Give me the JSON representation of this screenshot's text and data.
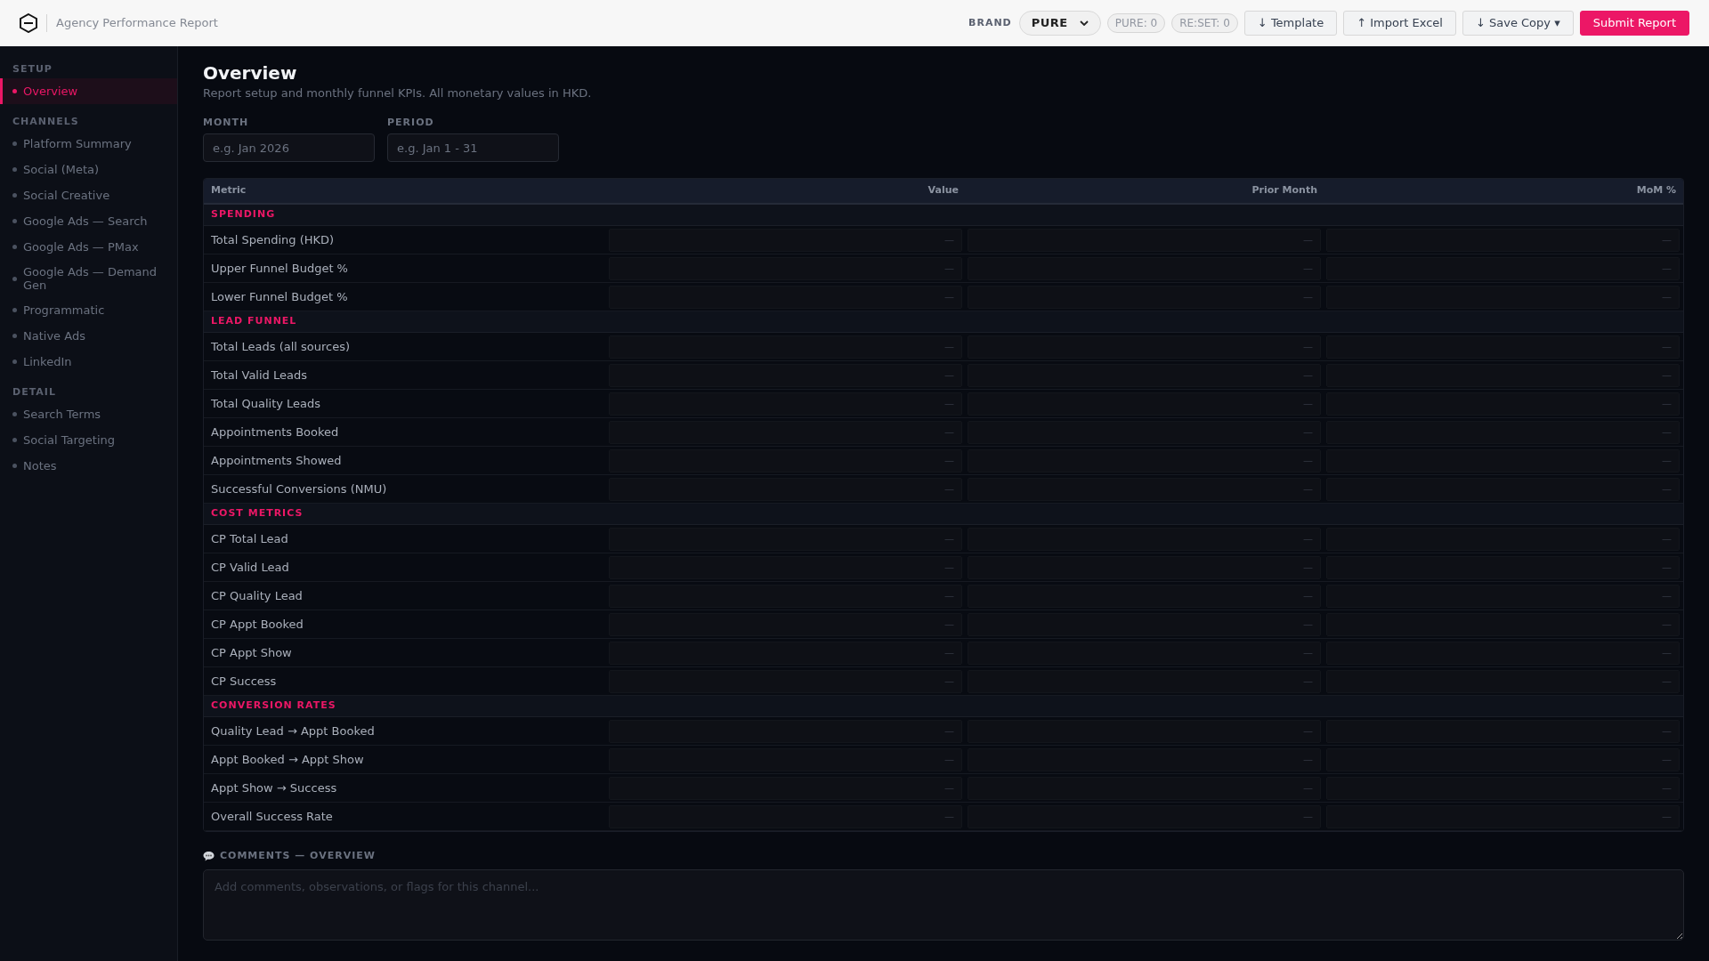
{
  "header": {
    "title": "Agency Performance Report",
    "brand_label": "BRAND",
    "brand_value": "PURE",
    "counters": [
      "PURE: 0",
      "RE:SET: 0"
    ],
    "buttons": [
      {
        "label": "↓ Template",
        "kind": "default"
      },
      {
        "label": "↑ Import Excel",
        "kind": "default"
      },
      {
        "label": "↓ Save Copy ▾",
        "kind": "default"
      },
      {
        "label": "Submit Report",
        "kind": "primary"
      }
    ]
  },
  "sidebar": {
    "sections": [
      {
        "heading": "SETUP",
        "items": [
          {
            "label": "Overview",
            "selected": true
          }
        ]
      },
      {
        "heading": "CHANNELS",
        "items": [
          {
            "label": "Platform Summary",
            "selected": false
          },
          {
            "label": "Social (Meta)",
            "selected": false
          },
          {
            "label": "Social Creative",
            "selected": false
          },
          {
            "label": "Google Ads — Search",
            "selected": false
          },
          {
            "label": "Google Ads — PMax",
            "selected": false
          },
          {
            "label": "Google Ads — Demand Gen",
            "selected": false
          },
          {
            "label": "Programmatic",
            "selected": false
          },
          {
            "label": "Native Ads",
            "selected": false
          },
          {
            "label": "LinkedIn",
            "selected": false
          }
        ]
      },
      {
        "heading": "DETAIL",
        "items": [
          {
            "label": "Search Terms",
            "selected": false
          },
          {
            "label": "Social Targeting",
            "selected": false
          },
          {
            "label": "Notes",
            "selected": false
          }
        ]
      }
    ]
  },
  "page": {
    "title": "Overview",
    "subtitle": "Report setup and monthly funnel KPIs. All monetary values in HKD.",
    "fields": [
      {
        "label": "MONTH",
        "placeholder": "e.g. Jan 2026"
      },
      {
        "label": "PERIOD",
        "placeholder": "e.g. Jan 1 - 31"
      }
    ]
  },
  "table": {
    "columns": [
      "Metric",
      "Value",
      "Prior Month",
      "MoM %"
    ],
    "groups": [
      {
        "heading": "SPENDING",
        "rows": [
          {
            "metric": "Total Spending (HKD)",
            "placeholders": [
              "—",
              "—",
              "—"
            ]
          },
          {
            "metric": "Upper Funnel Budget %",
            "placeholders": [
              "—",
              "—",
              "—"
            ]
          },
          {
            "metric": "Lower Funnel Budget %",
            "placeholders": [
              "—",
              "—",
              "—"
            ]
          }
        ]
      },
      {
        "heading": "LEAD FUNNEL",
        "rows": [
          {
            "metric": "Total Leads (all sources)",
            "placeholders": [
              "—",
              "—",
              "—"
            ]
          },
          {
            "metric": "Total Valid Leads",
            "placeholders": [
              "—",
              "—",
              "—"
            ]
          },
          {
            "metric": "Total Quality Leads",
            "placeholders": [
              "—",
              "—",
              "—"
            ]
          },
          {
            "metric": "Appointments Booked",
            "placeholders": [
              "—",
              "—",
              "—"
            ]
          },
          {
            "metric": "Appointments Showed",
            "placeholders": [
              "—",
              "—",
              "—"
            ]
          },
          {
            "metric": "Successful Conversions (NMU)",
            "placeholders": [
              "—",
              "—",
              "—"
            ]
          }
        ]
      },
      {
        "heading": "COST METRICS",
        "rows": [
          {
            "metric": "CP Total Lead",
            "placeholders": [
              "—",
              "—",
              "—"
            ]
          },
          {
            "metric": "CP Valid Lead",
            "placeholders": [
              "—",
              "—",
              "—"
            ]
          },
          {
            "metric": "CP Quality Lead",
            "placeholders": [
              "—",
              "—",
              "—"
            ]
          },
          {
            "metric": "CP Appt Booked",
            "placeholders": [
              "—",
              "—",
              "—"
            ]
          },
          {
            "metric": "CP Appt Show",
            "placeholders": [
              "—",
              "—",
              "—"
            ]
          },
          {
            "metric": "CP Success",
            "placeholders": [
              "—",
              "—",
              "—"
            ]
          }
        ]
      },
      {
        "heading": "CONVERSION RATES",
        "rows": [
          {
            "metric": "Quality Lead → Appt Booked",
            "placeholders": [
              "—",
              "—",
              "—"
            ]
          },
          {
            "metric": "Appt Booked → Appt Show",
            "placeholders": [
              "—",
              "—",
              "—"
            ]
          },
          {
            "metric": "Appt Show → Success",
            "placeholders": [
              "—",
              "—",
              "—"
            ]
          },
          {
            "metric": "Overall Success Rate",
            "placeholders": [
              "—",
              "—",
              "—"
            ]
          }
        ]
      }
    ]
  },
  "comments": {
    "label": "COMMENTS — OVERVIEW",
    "placeholder": "Add comments, observations, or flags for this channel..."
  }
}
